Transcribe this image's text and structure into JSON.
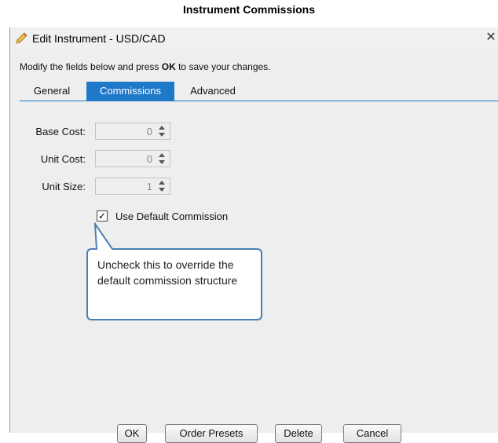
{
  "caption": "Instrument Commissions",
  "dialog": {
    "title": "Edit Instrument - USD/CAD",
    "close_glyph": "✕",
    "icon": "pencil-icon",
    "instructions_before": "Modify the fields below and press ",
    "instructions_bold": "OK",
    "instructions_after": " to save your changes."
  },
  "tabs": [
    {
      "label": "General",
      "active": false
    },
    {
      "label": "Commissions",
      "active": true
    },
    {
      "label": "Advanced",
      "active": false
    }
  ],
  "fields": {
    "base_cost": {
      "label": "Base Cost:",
      "value": "0"
    },
    "unit_cost": {
      "label": "Unit Cost:",
      "value": "0"
    },
    "unit_size": {
      "label": "Unit Size:",
      "value": "1"
    }
  },
  "use_default": {
    "label": "Use Default Commission",
    "checked": true,
    "glyph": "✓"
  },
  "callout": {
    "text": "Uncheck this to override the default commission structure"
  },
  "buttons": {
    "ok": "OK",
    "order_presets": "Order Presets",
    "delete": "Delete",
    "cancel": "Cancel"
  },
  "colors": {
    "tab_active": "#1f79c9",
    "dialog_bg": "#eeeeee",
    "callout_border": "#4a7fb5"
  }
}
